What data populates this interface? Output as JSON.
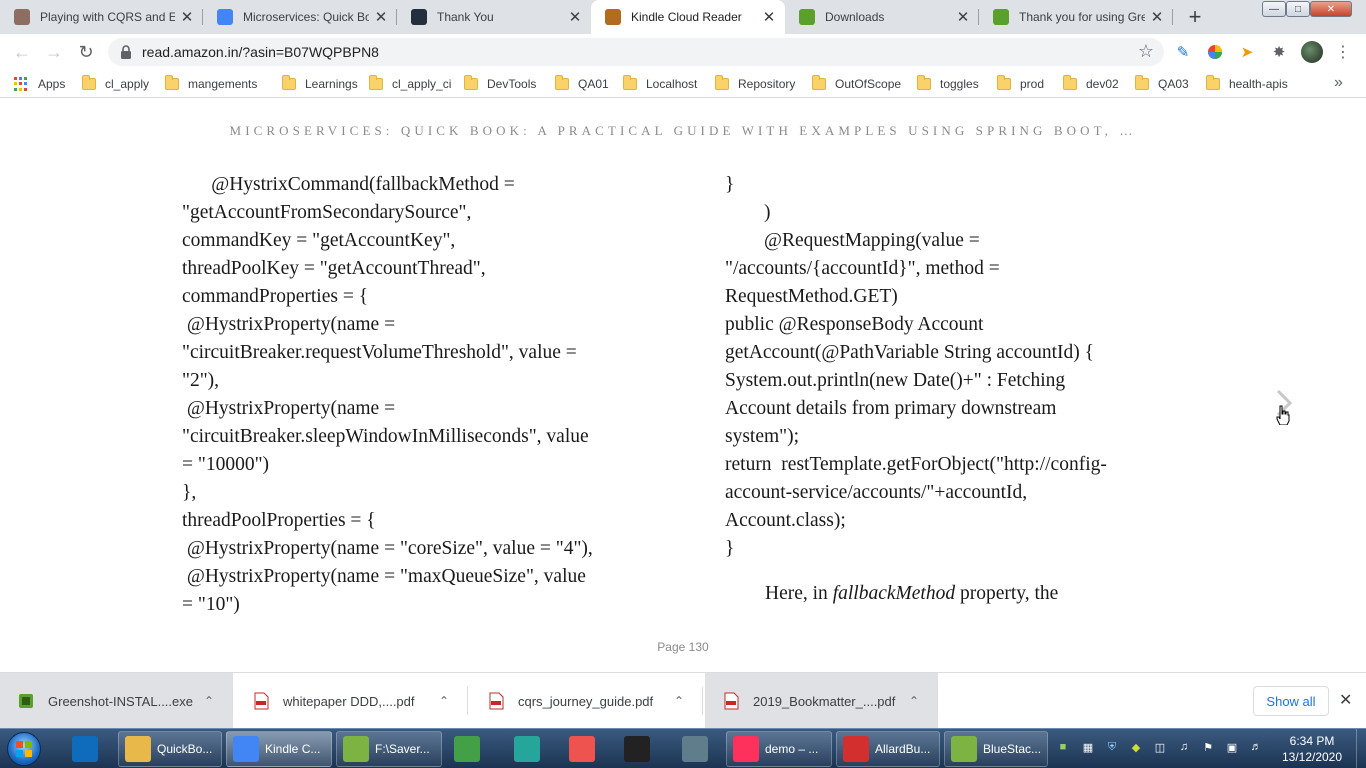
{
  "browser": {
    "tabs": [
      {
        "title": "Playing with CQRS and E",
        "icon": "avatar-icon",
        "color": "#8d6e63",
        "active": false
      },
      {
        "title": "Microservices: Quick Boo",
        "icon": "google-icon",
        "color": "#4285f4",
        "active": false
      },
      {
        "title": "Thank You",
        "icon": "amazon-icon",
        "color": "#232f3e",
        "active": false
      },
      {
        "title": "Kindle Cloud Reader",
        "icon": "kindle-icon",
        "color": "#b36b1f",
        "active": true
      },
      {
        "title": "Downloads",
        "icon": "greenshot-icon",
        "color": "#5aa02c",
        "active": false
      },
      {
        "title": "Thank you for using Gre",
        "icon": "greenshot-icon",
        "color": "#5aa02c",
        "active": false
      }
    ],
    "new_tab_label": "+",
    "url": "read.amazon.in/?asin=B07WQPBPN8",
    "bookmarks": [
      "Apps",
      "cl_apply",
      "mangements",
      "Learnings",
      "cl_apply_ci",
      "DevTools",
      "QA01",
      "Localhost",
      "Repository",
      "OutOfScope",
      "toggles",
      "prod",
      "dev02",
      "QA03",
      "health-apis"
    ],
    "bookmarks_overflow": "»"
  },
  "reader": {
    "book_title": "MICROSERVICES: QUICK BOOK: A PRACTICAL GUIDE WITH EXAMPLES USING SPRING BOOT, …",
    "left_column": [
      "      @HystrixCommand(fallbackMethod =",
      "\"getAccountFromSecondarySource\",",
      "commandKey = \"getAccountKey\",",
      "threadPoolKey = \"getAccountThread\",",
      "commandProperties = {",
      " @HystrixProperty(name =",
      "\"circuitBreaker.requestVolumeThreshold\", value =",
      "\"2\"),",
      " @HystrixProperty(name =",
      "\"circuitBreaker.sleepWindowInMilliseconds\", value",
      "= \"10000\")",
      "},",
      "threadPoolProperties = {",
      " @HystrixProperty(name = \"coreSize\", value = \"4\"),",
      " @HystrixProperty(name = \"maxQueueSize\", value",
      "= \"10\")"
    ],
    "right_column": [
      "}",
      "        )",
      "        @RequestMapping(value =",
      "\"/accounts/{accountId}\", method =",
      "RequestMethod.GET)",
      "public @ResponseBody Account",
      "getAccount(@PathVariable String accountId) {",
      "System.out.println(new Date()+\" : Fetching",
      "Account details from primary downstream",
      "system\");",
      "return  restTemplate.getForObject(\"http://config-",
      "account-service/accounts/\"+accountId,",
      "Account.class);",
      "}"
    ],
    "paragraph_before": "Here, in ",
    "paragraph_em": "fallbackMethod",
    "paragraph_after": " property, the",
    "page_label": "Page 130"
  },
  "downloads": {
    "items": [
      {
        "name": "Greenshot-INSTAL....exe",
        "icon": "installer-icon"
      },
      {
        "name": "whitepaper DDD,....pdf",
        "icon": "pdf-icon"
      },
      {
        "name": "cqrs_journey_guide.pdf",
        "icon": "pdf-icon"
      },
      {
        "name": "2019_Bookmatter_....pdf",
        "icon": "pdf-icon"
      }
    ],
    "show_all_label": "Show all"
  },
  "taskbar": {
    "items": [
      {
        "label": "",
        "icon": "outlook-icon",
        "color": "#0f6cbd"
      },
      {
        "label": "QuickBo...",
        "icon": "folder-icon",
        "color": "#e8b84a"
      },
      {
        "label": "Kindle C...",
        "icon": "chrome-icon",
        "color": "#4285f4"
      },
      {
        "label": "F:\\Saver...",
        "icon": "notepad-icon",
        "color": "#7cb342"
      },
      {
        "label": "",
        "icon": "timer-icon",
        "color": "#43a047"
      },
      {
        "label": "",
        "icon": "editor-icon",
        "color": "#26a69a"
      },
      {
        "label": "",
        "icon": "snipping-icon",
        "color": "#ef5350"
      },
      {
        "label": "",
        "icon": "cmd-icon",
        "color": "#222222"
      },
      {
        "label": "",
        "icon": "notes-icon",
        "color": "#607d8b"
      },
      {
        "label": "demo – ...",
        "icon": "intellij-icon",
        "color": "#fe315d"
      },
      {
        "label": "AllardBu...",
        "icon": "pdf-reader-icon",
        "color": "#d32f2f"
      },
      {
        "label": "BlueStac...",
        "icon": "bluestacks-icon",
        "color": "#7cb342"
      }
    ],
    "clock_time": "6:34 PM",
    "clock_date": "13/12/2020"
  }
}
